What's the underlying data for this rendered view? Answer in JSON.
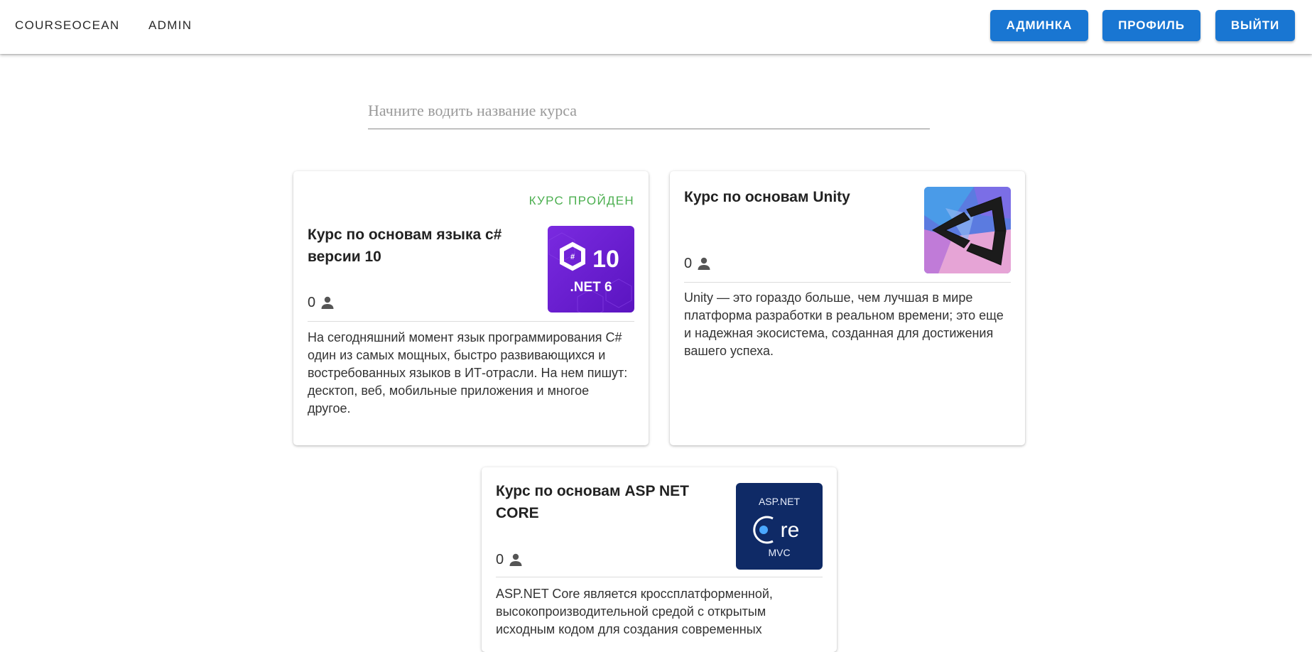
{
  "nav": {
    "brand": "COURSEOCEAN",
    "admin": "ADMIN",
    "buttons": {
      "adminka": "АДМИНКА",
      "profile": "ПРОФИЛЬ",
      "logout": "ВЫЙТИ"
    }
  },
  "search": {
    "placeholder": "Начните водить название курса",
    "value": ""
  },
  "courses": [
    {
      "status": "КУРС ПРОЙДЕН",
      "title": "Курс по основам языка c# версии 10",
      "students": "0",
      "description": "На сегодняшний момент язык программирования C# один из самых мощных, быстро развивающихся и востребованных языков в ИТ-отрасли. На нем пишут: десктоп, веб, мобильные приложения и многое другое.",
      "image": {
        "icon": "csharp-10-net6-logo",
        "line1": "C#10",
        "line2": ".NET 6"
      }
    },
    {
      "status": "",
      "title": "Курс по основам Unity",
      "students": "0",
      "description": "Unity — это гораздо больше, чем лучшая в мире платформа разработки в реальном времени; это еще и надежная экосистема, созданная для достижения вашего успеха.",
      "image": {
        "icon": "unity-logo"
      }
    },
    {
      "status": "",
      "title": "Курс по основам ASP NET CORE",
      "students": "0",
      "description": "ASP.NET Core является кроссплатформенной, высокопроизводительной средой с открытым исходным кодом для создания современных",
      "image": {
        "icon": "aspnet-core-mvc-logo",
        "line1": "ASP.NET",
        "line2": "Core",
        "line3": "MVC"
      }
    }
  ],
  "colors": {
    "primary": "#1976d2",
    "completed": "#4caf50",
    "csharp_bg": "#6a1fd1",
    "aspnet_bg": "#0f2a66"
  }
}
